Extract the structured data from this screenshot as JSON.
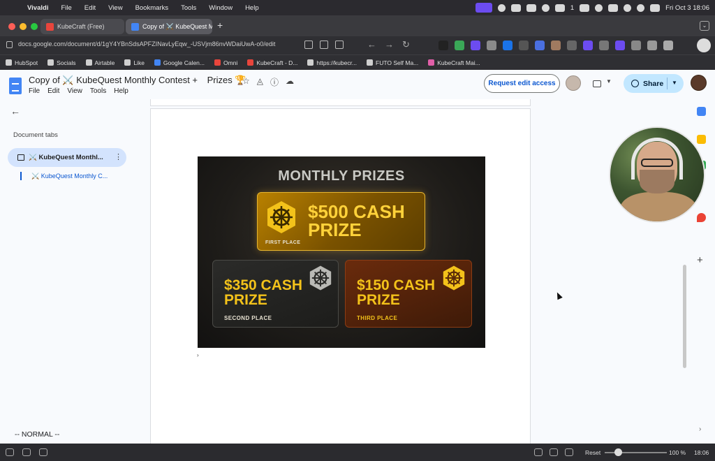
{
  "menubar": {
    "app_name": "Vivaldi",
    "items": [
      "File",
      "Edit",
      "View",
      "Bookmarks",
      "Tools",
      "Window",
      "Help"
    ],
    "badge_count": "1",
    "clock": "Fri Oct 3  18:06"
  },
  "tabs": [
    {
      "label": "KubeCraft (Free)",
      "favicon_color": "#e8453c"
    },
    {
      "label": "Copy of ⚔️ KubeQuest Mo",
      "favicon_color": "#4285f4"
    }
  ],
  "address": {
    "url": "docs.google.com/document/d/1gY4YBnSdsAPFZINavLyEqw_-USVjm86nvWDaiUwA-o0/edit"
  },
  "bookmarks": [
    {
      "label": "HubSpot",
      "color": "#cfcfcf"
    },
    {
      "label": "Socials",
      "color": "#cfcfcf"
    },
    {
      "label": "Airtable",
      "color": "#cfcfcf"
    },
    {
      "label": "Like",
      "color": "#cfcfcf"
    },
    {
      "label": "Google Calen...",
      "color": "#4285f4"
    },
    {
      "label": "Omni",
      "color": "#e8453c"
    },
    {
      "label": "KubeCraft - D...",
      "color": "#e8453c"
    },
    {
      "label": "https://kubecr...",
      "color": "#cfcfcf"
    },
    {
      "label": "FUTO Self Ma...",
      "color": "#cfcfcf"
    },
    {
      "label": "KubeCraft Mai...",
      "color": "#e05fa8"
    }
  ],
  "doc": {
    "title": "Copy of ⚔️ KubeQuest Monthly Contest +",
    "subtitle": "Prizes 🏆",
    "menus": [
      "File",
      "Edit",
      "View",
      "Tools",
      "Help"
    ],
    "request_button": "Request edit access",
    "share_button": "Share"
  },
  "outline": {
    "heading": "Document tabs",
    "tab_label": "⚔️ KubeQuest Monthl...",
    "subtab_label": "⚔️ KubeQuest Monthly C..."
  },
  "prizes": {
    "heading": "MONTHLY PRIZES",
    "first": {
      "amount": "$500 CASH PRIZE",
      "place": "FIRST PLACE"
    },
    "second": {
      "amount": "$350 CASH PRIZE",
      "place": "SECOND PLACE"
    },
    "third": {
      "amount": "$150 CASH PRIZE",
      "place": "THIRD PLACE"
    }
  },
  "vim_mode": "-- NORMAL --",
  "statusbar": {
    "reset": "Reset",
    "zoom": "100 %",
    "clock": "18:06"
  },
  "icons": {
    "kubernetes_helm": "helm-wheel-icon",
    "accent_gold": "#f3c21a"
  }
}
